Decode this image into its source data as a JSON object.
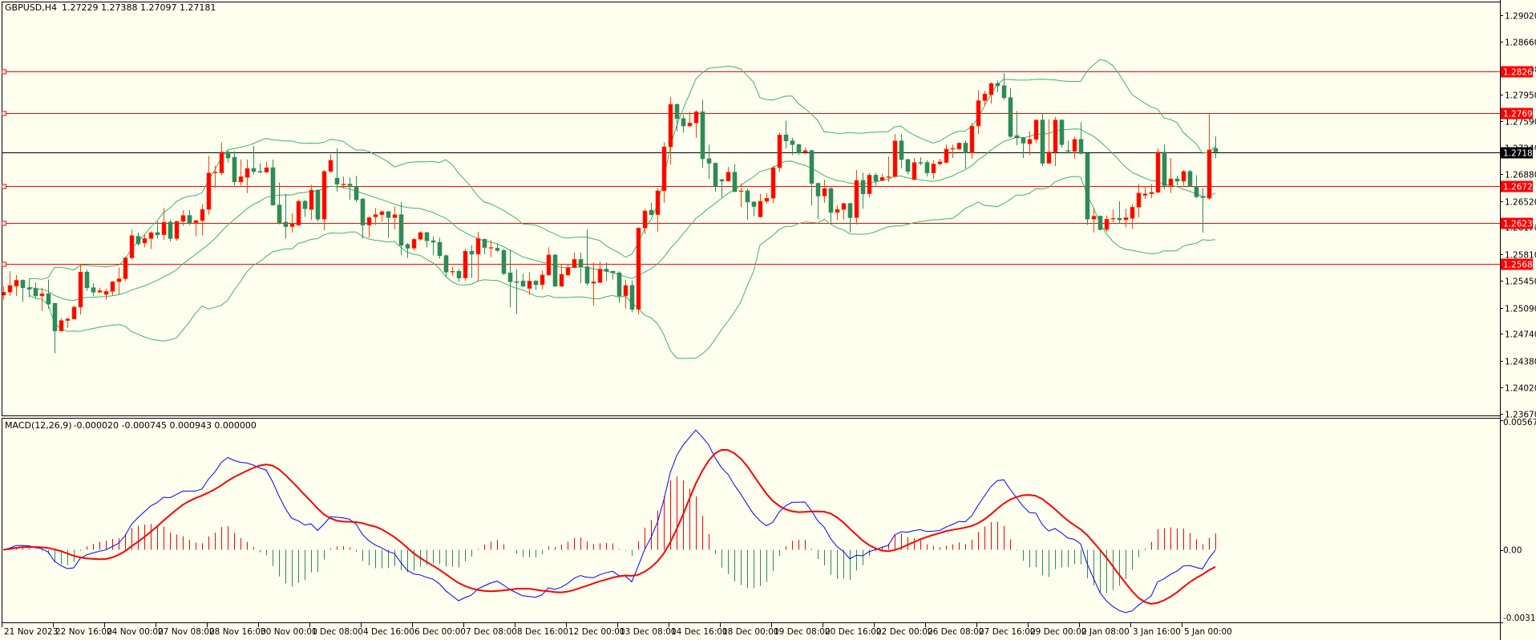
{
  "header": {
    "symbol": "GBPUSD,H4",
    "ohlc": "1.27229 1.27388 1.27097 1.27181"
  },
  "macd_header": {
    "label": "MACD(12,26,9)",
    "values": "-0.000020 -0.000745 0.000943 0.000000"
  },
  "colors": {
    "background": "#fffff0",
    "bull": "#ff0000",
    "bull_wick": "#ff4500",
    "bear": "#2e8b57",
    "bollinger": "#3cb371",
    "macd": "#0000ff",
    "signal": "#ff0000",
    "hline": "#ff0000",
    "bid": "#000000"
  },
  "chart_data": {
    "type": "candlestick",
    "title": "GBPUSD,H4",
    "ylim": [
      1.2367,
      1.2902
    ],
    "y_ticks": [
      "1.29020",
      "1.28660",
      "1.28300",
      "1.27950",
      "1.27590",
      "1.27240",
      "1.26880",
      "1.26520",
      "1.26170",
      "1.25810",
      "1.25450",
      "1.25090",
      "1.24740",
      "1.24380",
      "1.24020",
      "1.23670"
    ],
    "horizontal_lines": [
      {
        "price": 1.28262,
        "label": "1.28262"
      },
      {
        "price": 1.27699,
        "label": "1.27699"
      },
      {
        "price": 1.26725,
        "label": "1.26725"
      },
      {
        "price": 1.2623,
        "label": "1.26230"
      },
      {
        "price": 1.2568,
        "label": "1.25680"
      }
    ],
    "bid": {
      "price": 1.27181,
      "label": "1.27181"
    },
    "x_labels": [
      {
        "bar": 0,
        "label": "21 Nov 2023"
      },
      {
        "bar": 8,
        "label": "22 Nov 16:00"
      },
      {
        "bar": 16,
        "label": "24 Nov 00:00"
      },
      {
        "bar": 24,
        "label": "27 Nov 08:00"
      },
      {
        "bar": 32,
        "label": "28 Nov 16:00"
      },
      {
        "bar": 40,
        "label": "30 Nov 00:00"
      },
      {
        "bar": 48,
        "label": "1 Dec 08:00"
      },
      {
        "bar": 56,
        "label": "4 Dec 16:00"
      },
      {
        "bar": 64,
        "label": "6 Dec 00:00"
      },
      {
        "bar": 72,
        "label": "7 Dec 08:00"
      },
      {
        "bar": 80,
        "label": "8 Dec 16:00"
      },
      {
        "bar": 88,
        "label": "12 Dec 00:00"
      },
      {
        "bar": 96,
        "label": "13 Dec 08:00"
      },
      {
        "bar": 104,
        "label": "14 Dec 16:00"
      },
      {
        "bar": 112,
        "label": "18 Dec 00:00"
      },
      {
        "bar": 120,
        "label": "19 Dec 08:00"
      },
      {
        "bar": 128,
        "label": "20 Dec 16:00"
      },
      {
        "bar": 136,
        "label": "22 Dec 00:00"
      },
      {
        "bar": 144,
        "label": "26 Dec 08:00"
      },
      {
        "bar": 152,
        "label": "27 Dec 16:00"
      },
      {
        "bar": 160,
        "label": "29 Dec 00:00"
      },
      {
        "bar": 168,
        "label": "2 Jan 08:00"
      },
      {
        "bar": 176,
        "label": "3 Jan 16:00"
      },
      {
        "bar": 184,
        "label": "5 Jan 00:00"
      }
    ],
    "indicators": {
      "bollinger": {
        "period": 20,
        "deviation": 2
      },
      "macd": {
        "fast": 12,
        "slow": 26,
        "signal": 9,
        "ylim": [
          -0.003178,
          0.005674
        ],
        "ticks": [
          {
            "value": 0.005674,
            "label": "0.005674"
          },
          {
            "value": 0,
            "label": "0.00"
          },
          {
            "value": -0.003178,
            "label": "-0.003178"
          }
        ]
      }
    },
    "candles_format": [
      "open",
      "high",
      "low",
      "close"
    ],
    "candles": [
      [
        1.2526,
        1.2538,
        1.2519,
        1.253
      ],
      [
        1.253,
        1.2558,
        1.2525,
        1.2539
      ],
      [
        1.2538,
        1.2553,
        1.2525,
        1.2546
      ],
      [
        1.2546,
        1.2547,
        1.2517,
        1.2536
      ],
      [
        1.2536,
        1.2548,
        1.2523,
        1.2534
      ],
      [
        1.2535,
        1.2543,
        1.2522,
        1.2525
      ],
      [
        1.2525,
        1.2536,
        1.2505,
        1.2528
      ],
      [
        1.2528,
        1.2547,
        1.2508,
        1.2514
      ],
      [
        1.2515,
        1.2516,
        1.2448,
        1.2478
      ],
      [
        1.2478,
        1.2495,
        1.2477,
        1.2492
      ],
      [
        1.2492,
        1.2496,
        1.2482,
        1.2494
      ],
      [
        1.2494,
        1.2512,
        1.2494,
        1.251
      ],
      [
        1.251,
        1.2568,
        1.25,
        1.2557
      ],
      [
        1.2557,
        1.256,
        1.2532,
        1.2536
      ],
      [
        1.2536,
        1.2542,
        1.2525,
        1.253
      ],
      [
        1.253,
        1.2536,
        1.2529,
        1.2532
      ],
      [
        1.2527,
        1.2535,
        1.252,
        1.2531
      ],
      [
        1.2531,
        1.2545,
        1.2525,
        1.2544
      ],
      [
        1.2544,
        1.2563,
        1.2527,
        1.2548
      ],
      [
        1.2548,
        1.2578,
        1.2545,
        1.2576
      ],
      [
        1.2576,
        1.2614,
        1.2574,
        1.2606
      ],
      [
        1.2605,
        1.261,
        1.2592,
        1.2595
      ],
      [
        1.2596,
        1.2608,
        1.259,
        1.2602
      ],
      [
        1.2602,
        1.2612,
        1.2588,
        1.261
      ],
      [
        1.261,
        1.2625,
        1.2602,
        1.2607
      ],
      [
        1.2607,
        1.2643,
        1.26,
        1.2624
      ],
      [
        1.2624,
        1.2627,
        1.2598,
        1.2602
      ],
      [
        1.2602,
        1.2626,
        1.2599,
        1.2625
      ],
      [
        1.2625,
        1.264,
        1.2619,
        1.2633
      ],
      [
        1.2633,
        1.264,
        1.262,
        1.2623
      ],
      [
        1.2623,
        1.2627,
        1.2605,
        1.2626
      ],
      [
        1.2626,
        1.2648,
        1.2606,
        1.2641
      ],
      [
        1.2641,
        1.2713,
        1.2634,
        1.269
      ],
      [
        1.269,
        1.27,
        1.267,
        1.2691
      ],
      [
        1.269,
        1.2731,
        1.2687,
        1.2718
      ],
      [
        1.2718,
        1.272,
        1.2704,
        1.271
      ],
      [
        1.2711,
        1.2719,
        1.2673,
        1.2678
      ],
      [
        1.2678,
        1.2708,
        1.2673,
        1.2685
      ],
      [
        1.2684,
        1.2708,
        1.2663,
        1.2696
      ],
      [
        1.2696,
        1.2726,
        1.2688,
        1.2692
      ],
      [
        1.2692,
        1.2703,
        1.269,
        1.2691
      ],
      [
        1.2691,
        1.2705,
        1.269,
        1.2697
      ],
      [
        1.2697,
        1.2708,
        1.2646,
        1.2647
      ],
      [
        1.2647,
        1.2677,
        1.2621,
        1.2623
      ],
      [
        1.2624,
        1.2662,
        1.2602,
        1.2618
      ],
      [
        1.2618,
        1.2636,
        1.261,
        1.2622
      ],
      [
        1.262,
        1.2654,
        1.2619,
        1.2652
      ],
      [
        1.2652,
        1.2654,
        1.2631,
        1.2642
      ],
      [
        1.2641,
        1.2674,
        1.2627,
        1.2667
      ],
      [
        1.2667,
        1.2668,
        1.2625,
        1.2628
      ],
      [
        1.2628,
        1.2694,
        1.2613,
        1.2692
      ],
      [
        1.2692,
        1.2715,
        1.269,
        1.2707
      ],
      [
        1.2683,
        1.2723,
        1.2665,
        1.2675
      ],
      [
        1.2674,
        1.2685,
        1.2669,
        1.2675
      ],
      [
        1.2675,
        1.2684,
        1.2654,
        1.2673
      ],
      [
        1.2672,
        1.2686,
        1.2651,
        1.2654
      ],
      [
        1.2655,
        1.2656,
        1.2602,
        1.262
      ],
      [
        1.262,
        1.2632,
        1.2603,
        1.263
      ],
      [
        1.2631,
        1.2643,
        1.262,
        1.2634
      ],
      [
        1.2634,
        1.264,
        1.2625,
        1.2638
      ],
      [
        1.2638,
        1.2639,
        1.2603,
        1.263
      ],
      [
        1.263,
        1.2645,
        1.2614,
        1.2634
      ],
      [
        1.2634,
        1.2651,
        1.258,
        1.2593
      ],
      [
        1.2594,
        1.2596,
        1.2576,
        1.2589
      ],
      [
        1.2589,
        1.2603,
        1.2586,
        1.2601
      ],
      [
        1.2601,
        1.2612,
        1.2599,
        1.261
      ],
      [
        1.261,
        1.2611,
        1.259,
        1.2599
      ],
      [
        1.2599,
        1.2605,
        1.258,
        1.2597
      ],
      [
        1.2597,
        1.2603,
        1.2575,
        1.2579
      ],
      [
        1.2579,
        1.2581,
        1.255,
        1.2557
      ],
      [
        1.2557,
        1.2564,
        1.2552,
        1.2558
      ],
      [
        1.2558,
        1.2561,
        1.2544,
        1.2549
      ],
      [
        1.2549,
        1.2588,
        1.2545,
        1.2585
      ],
      [
        1.2585,
        1.2593,
        1.2549,
        1.2581
      ],
      [
        1.2581,
        1.2611,
        1.2544,
        1.2602
      ],
      [
        1.2601,
        1.2602,
        1.2581,
        1.259
      ],
      [
        1.2589,
        1.26,
        1.2577,
        1.259
      ],
      [
        1.2589,
        1.2596,
        1.2584,
        1.2586
      ],
      [
        1.2586,
        1.2588,
        1.2553,
        1.2555
      ],
      [
        1.2556,
        1.2587,
        1.251,
        1.2544
      ],
      [
        1.2544,
        1.2561,
        1.2501,
        1.2544
      ],
      [
        1.2545,
        1.2555,
        1.2537,
        1.2538
      ],
      [
        1.2535,
        1.2557,
        1.2526,
        1.2545
      ],
      [
        1.2545,
        1.2546,
        1.2533,
        1.254
      ],
      [
        1.254,
        1.2559,
        1.2534,
        1.2553
      ],
      [
        1.2553,
        1.259,
        1.2552,
        1.258
      ],
      [
        1.258,
        1.2581,
        1.2537,
        1.2538
      ],
      [
        1.2538,
        1.2567,
        1.2537,
        1.2554
      ],
      [
        1.2553,
        1.2567,
        1.2552,
        1.2563
      ],
      [
        1.2563,
        1.2583,
        1.2562,
        1.2574
      ],
      [
        1.2574,
        1.2583,
        1.2542,
        1.2564
      ],
      [
        1.2564,
        1.2614,
        1.2539,
        1.2542
      ],
      [
        1.2542,
        1.257,
        1.2512,
        1.2544
      ],
      [
        1.2543,
        1.2571,
        1.2542,
        1.2561
      ],
      [
        1.2561,
        1.257,
        1.2545,
        1.2558
      ],
      [
        1.2558,
        1.2559,
        1.2547,
        1.2556
      ],
      [
        1.2556,
        1.2558,
        1.2516,
        1.2525
      ],
      [
        1.2525,
        1.2547,
        1.2508,
        1.2539
      ],
      [
        1.2539,
        1.2546,
        1.2503,
        1.2507
      ],
      [
        1.2507,
        1.2617,
        1.25,
        1.2616
      ],
      [
        1.2616,
        1.2642,
        1.2608,
        1.2639
      ],
      [
        1.264,
        1.265,
        1.2633,
        1.2634
      ],
      [
        1.2634,
        1.2669,
        1.2611,
        1.2666
      ],
      [
        1.2666,
        1.2731,
        1.265,
        1.2725
      ],
      [
        1.2725,
        1.2792,
        1.2701,
        1.2782
      ],
      [
        1.2782,
        1.2783,
        1.2746,
        1.2763
      ],
      [
        1.2763,
        1.2768,
        1.2744,
        1.2753
      ],
      [
        1.2753,
        1.2772,
        1.2752,
        1.2757
      ],
      [
        1.2757,
        1.2774,
        1.2737,
        1.2772
      ],
      [
        1.2772,
        1.2788,
        1.2697,
        1.2709
      ],
      [
        1.2709,
        1.2728,
        1.2682,
        1.2703
      ],
      [
        1.2703,
        1.2704,
        1.2665,
        1.2672
      ],
      [
        1.2681,
        1.2682,
        1.2657,
        1.2679
      ],
      [
        1.2679,
        1.2698,
        1.2679,
        1.2691
      ],
      [
        1.2691,
        1.2702,
        1.2664,
        1.2665
      ],
      [
        1.2665,
        1.2676,
        1.2644,
        1.2666
      ],
      [
        1.2666,
        1.2669,
        1.2627,
        1.2651
      ],
      [
        1.2651,
        1.2652,
        1.2632,
        1.2645
      ],
      [
        1.2631,
        1.2662,
        1.263,
        1.2652
      ],
      [
        1.2652,
        1.2663,
        1.2649,
        1.2656
      ],
      [
        1.2656,
        1.27,
        1.2649,
        1.2697
      ],
      [
        1.2697,
        1.2744,
        1.2691,
        1.2741
      ],
      [
        1.2741,
        1.276,
        1.2723,
        1.2733
      ],
      [
        1.2733,
        1.2737,
        1.2714,
        1.2728
      ],
      [
        1.2728,
        1.2729,
        1.2714,
        1.2717
      ],
      [
        1.2718,
        1.2724,
        1.2715,
        1.272
      ],
      [
        1.272,
        1.2721,
        1.2646,
        1.2676
      ],
      [
        1.2676,
        1.2677,
        1.2628,
        1.2659
      ],
      [
        1.2659,
        1.2681,
        1.265,
        1.2669
      ],
      [
        1.2669,
        1.2671,
        1.2623,
        1.2637
      ],
      [
        1.2637,
        1.2647,
        1.2627,
        1.2641
      ],
      [
        1.2641,
        1.265,
        1.2627,
        1.2649
      ],
      [
        1.2649,
        1.265,
        1.261,
        1.263
      ],
      [
        1.263,
        1.2694,
        1.2621,
        1.268
      ],
      [
        1.268,
        1.269,
        1.2642,
        1.2662
      ],
      [
        1.2662,
        1.269,
        1.2657,
        1.2687
      ],
      [
        1.2687,
        1.269,
        1.2673,
        1.2679
      ],
      [
        1.268,
        1.2689,
        1.2679,
        1.2684
      ],
      [
        1.2684,
        1.2712,
        1.2678,
        1.2685
      ],
      [
        1.2685,
        1.2742,
        1.2684,
        1.2733
      ],
      [
        1.2733,
        1.2742,
        1.2696,
        1.2708
      ],
      [
        1.2708,
        1.2709,
        1.2688,
        1.2692
      ],
      [
        1.2681,
        1.271,
        1.268,
        1.2704
      ],
      [
        1.2704,
        1.2711,
        1.27,
        1.2704
      ],
      [
        1.2704,
        1.2707,
        1.2685,
        1.269
      ],
      [
        1.269,
        1.2707,
        1.2682,
        1.2702
      ],
      [
        1.2702,
        1.2709,
        1.27,
        1.2705
      ],
      [
        1.2704,
        1.2728,
        1.2703,
        1.2722
      ],
      [
        1.2722,
        1.2728,
        1.271,
        1.2723
      ],
      [
        1.2722,
        1.2731,
        1.2721,
        1.273
      ],
      [
        1.273,
        1.2734,
        1.2696,
        1.2717
      ],
      [
        1.2717,
        1.2757,
        1.2709,
        1.2753
      ],
      [
        1.2753,
        1.2801,
        1.2742,
        1.2787
      ],
      [
        1.2787,
        1.28,
        1.278,
        1.2796
      ],
      [
        1.2795,
        1.2812,
        1.2783,
        1.281
      ],
      [
        1.281,
        1.2814,
        1.2798,
        1.2807
      ],
      [
        1.2807,
        1.2824,
        1.2788,
        1.2791
      ],
      [
        1.2791,
        1.2804,
        1.2737,
        1.2739
      ],
      [
        1.274,
        1.2773,
        1.2727,
        1.2737
      ],
      [
        1.2737,
        1.2738,
        1.271,
        1.273
      ],
      [
        1.2729,
        1.2746,
        1.2714,
        1.2735
      ],
      [
        1.2735,
        1.2762,
        1.273,
        1.2761
      ],
      [
        1.2761,
        1.277,
        1.2699,
        1.2703
      ],
      [
        1.2703,
        1.2762,
        1.2702,
        1.2718
      ],
      [
        1.2718,
        1.2765,
        1.2699,
        1.2761
      ],
      [
        1.2761,
        1.2762,
        1.2724,
        1.2728
      ],
      [
        1.272,
        1.2733,
        1.2716,
        1.2719
      ],
      [
        1.2719,
        1.2739,
        1.2709,
        1.2735
      ],
      [
        1.2735,
        1.2758,
        1.2715,
        1.2716
      ],
      [
        1.2716,
        1.2717,
        1.262,
        1.2628
      ],
      [
        1.2628,
        1.2643,
        1.261,
        1.2632
      ],
      [
        1.2632,
        1.2633,
        1.2613,
        1.2614
      ],
      [
        1.2614,
        1.2633,
        1.2611,
        1.2628
      ],
      [
        1.2628,
        1.2641,
        1.2624,
        1.2629
      ],
      [
        1.2629,
        1.2652,
        1.2623,
        1.2627
      ],
      [
        1.2627,
        1.2642,
        1.2617,
        1.263
      ],
      [
        1.2629,
        1.2648,
        1.2615,
        1.2644
      ],
      [
        1.2644,
        1.2675,
        1.263,
        1.2663
      ],
      [
        1.266,
        1.2672,
        1.2655,
        1.2662
      ],
      [
        1.2662,
        1.2675,
        1.2656,
        1.2664
      ],
      [
        1.2664,
        1.2723,
        1.2663,
        1.2718
      ],
      [
        1.2718,
        1.2728,
        1.2668,
        1.2673
      ],
      [
        1.2673,
        1.271,
        1.2663,
        1.2682
      ],
      [
        1.2682,
        1.2686,
        1.2673,
        1.2679
      ],
      [
        1.2679,
        1.2694,
        1.2673,
        1.2692
      ],
      [
        1.2692,
        1.2694,
        1.2672,
        1.2672
      ],
      [
        1.2672,
        1.2687,
        1.2656,
        1.2658
      ],
      [
        1.2658,
        1.267,
        1.261,
        1.2657
      ],
      [
        1.2656,
        1.2769,
        1.2654,
        1.2721
      ],
      [
        1.27229,
        1.27388,
        1.27097,
        1.27181
      ]
    ]
  }
}
